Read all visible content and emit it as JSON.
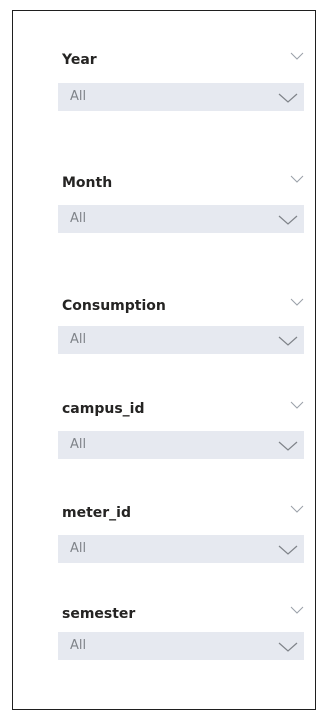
{
  "slicers": [
    {
      "title": "Year",
      "value": "All"
    },
    {
      "title": "Month",
      "value": "All"
    },
    {
      "title": "Consumption",
      "value": "All"
    },
    {
      "title": "campus_id",
      "value": "All"
    },
    {
      "title": "meter_id",
      "value": "All"
    },
    {
      "title": "semester",
      "value": "All"
    }
  ],
  "icons": {
    "header_chevron": "chevron-down-icon",
    "dropdown_chevron": "chevron-down-icon"
  },
  "colors": {
    "dropdown_background": "#e6e9f0",
    "title_text": "#252423",
    "value_text": "#7f8389",
    "chevron": "#9aa0a8",
    "border": "#1f1f1f"
  }
}
